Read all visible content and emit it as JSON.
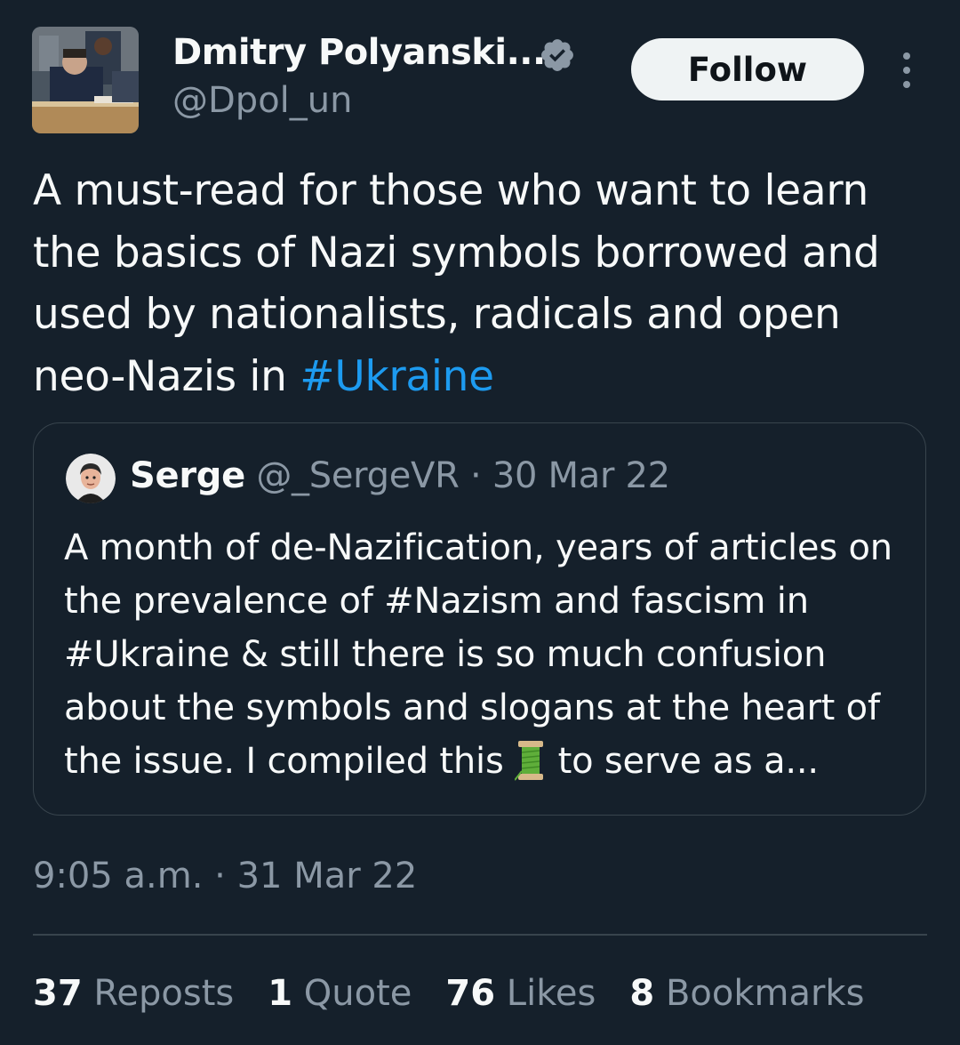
{
  "author": {
    "name": "Dmitry Polyanski...",
    "handle": "@Dpol_un",
    "verified_color": "#8b98a5"
  },
  "follow_label": "Follow",
  "tweet": {
    "text_plain": "A must-read for those who want to learn the basics of Nazi symbols borrowed and used by nationalists, radicals and open neo-Nazis in ",
    "hashtag": "#Ukraine",
    "link_color": "#1d9bf0"
  },
  "quote": {
    "name": "Serge",
    "handle": "@_SergeVR",
    "separator": " · ",
    "date": "30 Mar 22",
    "text_before_emoji": "A month of de-Nazification, years of articles on the prevalence of #Nazism and fascism in #Ukraine & still there is so much confusion about the symbols and slogans at the heart of the issue. I compiled this ",
    "emoji": "spool-of-thread-icon",
    "text_after_emoji": " to serve as a..."
  },
  "timestamp": "9:05 a.m. · 31 Mar 22",
  "stats": {
    "reposts_count": "37",
    "reposts_label": "Reposts",
    "quotes_count": "1",
    "quotes_label": "Quote",
    "likes_count": "76",
    "likes_label": "Likes",
    "bookmarks_count": "8",
    "bookmarks_label": "Bookmarks"
  },
  "colors": {
    "background": "#15202b",
    "primary_text": "#f7f9f9",
    "secondary_text": "#8b98a5",
    "border": "#38444d"
  }
}
